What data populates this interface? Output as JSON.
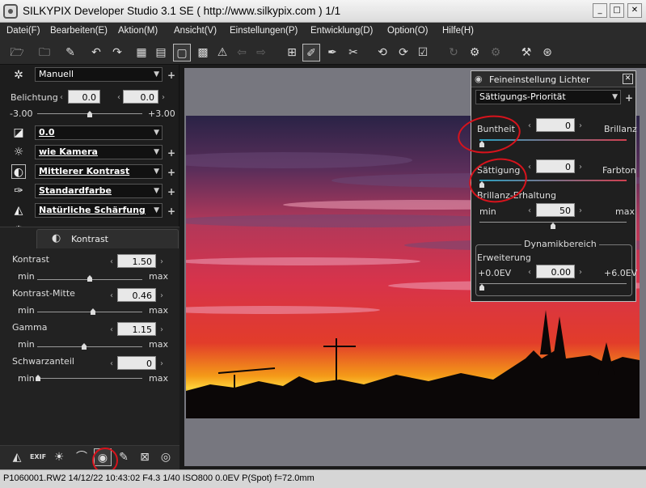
{
  "window": {
    "title": "SILKYPIX Developer Studio 3.1 SE ( http://www.silkypix.com )    1/1",
    "minimize": "_",
    "maximize": "□",
    "close": "✕"
  },
  "menu": [
    "Datei(F)",
    "Bearbeiten(E)",
    "Aktion(M)",
    "Ansicht(V)",
    "Einstellungen(P)",
    "Entwicklung(D)",
    "Option(O)",
    "Hilfe(H)"
  ],
  "toolbar": {
    "icons": [
      "folder-open-icon",
      "folder-browse-icon",
      "brush-icon",
      "undo-icon",
      "redo-icon",
      "grid-icon",
      "split-view-icon",
      "single-view-icon",
      "thumbnails-icon",
      "warning-icon",
      "prev-icon",
      "next-icon",
      "crop-grid-icon",
      "edit-tool-icon",
      "pen-tool-icon",
      "magic-tool-icon",
      "rotate-left-icon",
      "rotate-right-icon",
      "checkbox-icon",
      "refresh-icon",
      "gear-settings-icon",
      "gear-link-icon",
      "hammer-icon",
      "develop-icon"
    ]
  },
  "left": {
    "preset": "Manuell",
    "belichtung_label": "Belichtung",
    "belichtung_value1": "0.0",
    "belichtung_value2": "0.0",
    "belichtung_min": "-3.00",
    "belichtung_max": "+3.00",
    "wb_value": "0.0",
    "color_value": "wie Kamera",
    "contrast_value": "Mittlerer Kontrast",
    "color_style_value": "Standardfarbe",
    "sharpness_value": "Natürliche Schärfung",
    "tab_label": "Kontrast",
    "sliders": [
      {
        "label": "Kontrast",
        "value": "1.50",
        "min": "min",
        "max": "max",
        "pos": 0.5
      },
      {
        "label": "Kontrast-Mitte",
        "value": "0.46",
        "min": "min",
        "max": "max",
        "pos": 0.46
      },
      {
        "label": "Gamma",
        "value": "1.15",
        "min": "min",
        "max": "max",
        "pos": 0.38
      },
      {
        "label": "Schwarzanteil",
        "value": "0",
        "min": "min",
        "max": "max",
        "pos": 0.0
      }
    ]
  },
  "dialog": {
    "title": "Feineinstellung Lichter",
    "mode": "Sättigungs-Priorität",
    "buntheit_label": "Buntheit",
    "buntheit_value": "0",
    "brillanz_label": "Brillanz",
    "saettigung_label": "Sättigung",
    "saettigung_value": "0",
    "farbton_label": "Farbton",
    "brillanz_erhaltung_label": "Brillanz-Erhaltung",
    "be_min": "min",
    "be_max": "max",
    "be_value": "50",
    "dynamik_label": "Dynamikbereich",
    "erweiterung_label": "Erweiterung",
    "erw_min": "+0.0EV",
    "erw_max": "+6.0EV",
    "erw_value": "0.00"
  },
  "status": "P1060001.RW2 14/12/22 10:43:02 F4.3 1/40 ISO800  0.0EV P(Spot) f=72.0mm",
  "bottom_tools": [
    "histogram-icon",
    "exif-icon",
    "light-icon",
    "curve-icon",
    "highlight-tune-icon",
    "paint-icon",
    "transform-icon",
    "lens-icon"
  ],
  "colors": {
    "annotation": "#d8131c",
    "canvas": "#77777f"
  }
}
